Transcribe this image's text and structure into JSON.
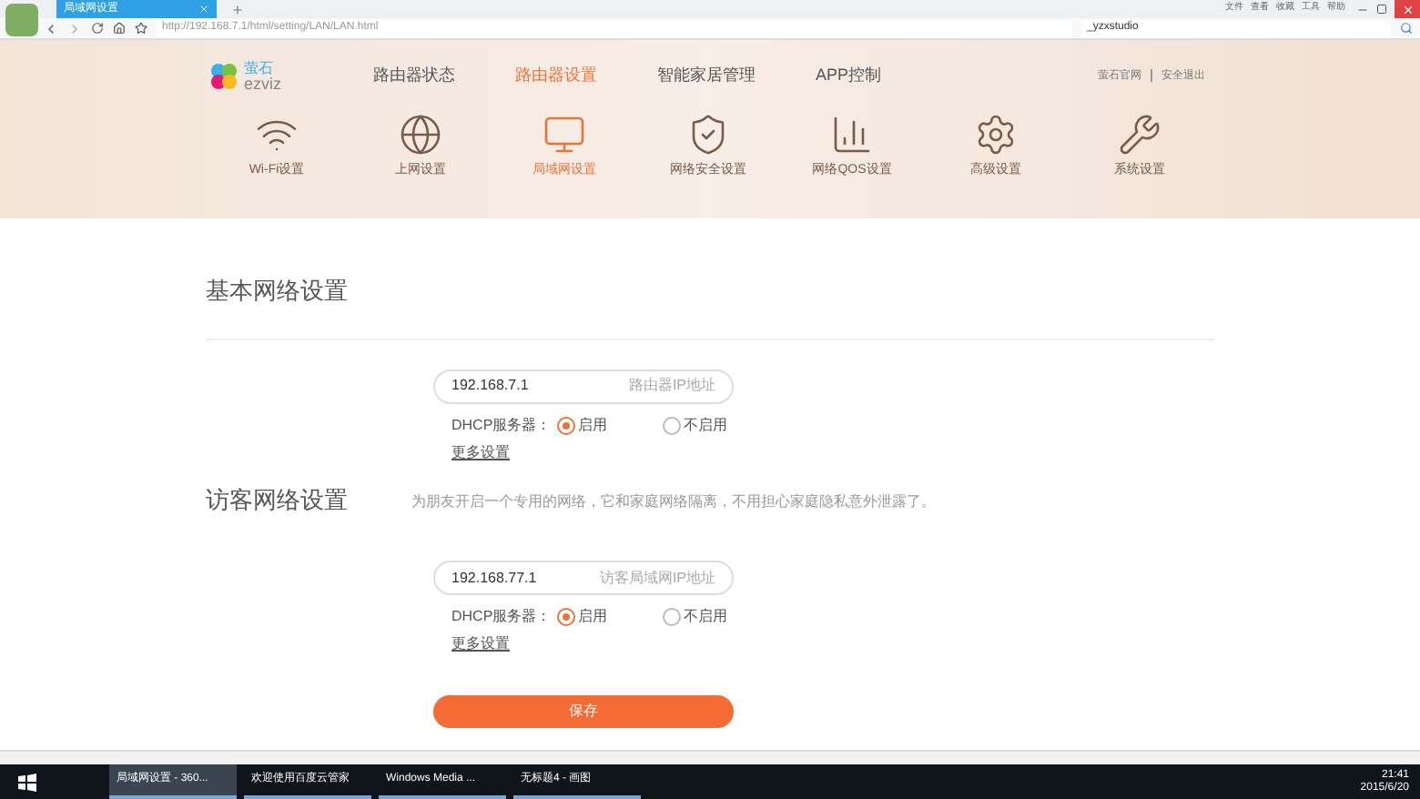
{
  "browser": {
    "tab": {
      "title": "局域网设置"
    },
    "address": "http://192.168.7.1/html/setting/LAN/LAN.html",
    "menu": [
      "文件",
      "查看",
      "收藏",
      "工具",
      "帮助"
    ],
    "search": "_yzxstudio"
  },
  "header": {
    "logo_cn": "萤石",
    "logo_en": "ezviz",
    "nav": [
      {
        "label": "路由器状态",
        "selected": false
      },
      {
        "label": "路由器设置",
        "selected": true
      },
      {
        "label": "智能家居管理",
        "selected": false
      },
      {
        "label": "APP控制",
        "selected": false
      }
    ],
    "links": [
      "萤石官网",
      "安全退出"
    ],
    "tools": [
      {
        "kind": "wifi",
        "label": "Wi-Fi设置",
        "selected": false
      },
      {
        "kind": "globe",
        "label": "上网设置",
        "selected": false
      },
      {
        "kind": "monitor",
        "label": "局域网设置",
        "selected": true
      },
      {
        "kind": "shield",
        "label": "网络安全设置",
        "selected": false
      },
      {
        "kind": "chart",
        "label": "网络QOS设置",
        "selected": false
      },
      {
        "kind": "gear",
        "label": "高级设置",
        "selected": false
      },
      {
        "kind": "wrench",
        "label": "系统设置",
        "selected": false
      }
    ]
  },
  "sections": [
    {
      "title": "基本网络设置",
      "ip": "192.168.7.1",
      "ip_hint": "路由器IP地址",
      "dhcp_label": "DHCP服务器：",
      "options": [
        {
          "label": "启用",
          "selected": true
        },
        {
          "label": "不启用",
          "selected": false
        }
      ],
      "more": "更多设置"
    },
    {
      "title": "访客网络设置",
      "description": "为朋友开启一个专用的网络，它和家庭网络隔离，不用担心家庭隐私意外泄露了。",
      "ip": "192.168.77.1",
      "ip_hint": "访客局域网IP地址",
      "dhcp_label": "DHCP服务器：",
      "options": [
        {
          "label": "启用",
          "selected": true
        },
        {
          "label": "不启用",
          "selected": false
        }
      ],
      "more": "更多设置"
    }
  ],
  "save_button": "保存",
  "taskbar": {
    "items": [
      {
        "label": "局域网设置 - 360...",
        "selected": true
      },
      {
        "label": "欢迎使用百度云管家",
        "selected": false
      },
      {
        "label": "Windows Media ...",
        "selected": false
      },
      {
        "label": "无标题4 - 画图",
        "selected": false
      }
    ],
    "time": "21:41",
    "date": "2015/6/20"
  }
}
